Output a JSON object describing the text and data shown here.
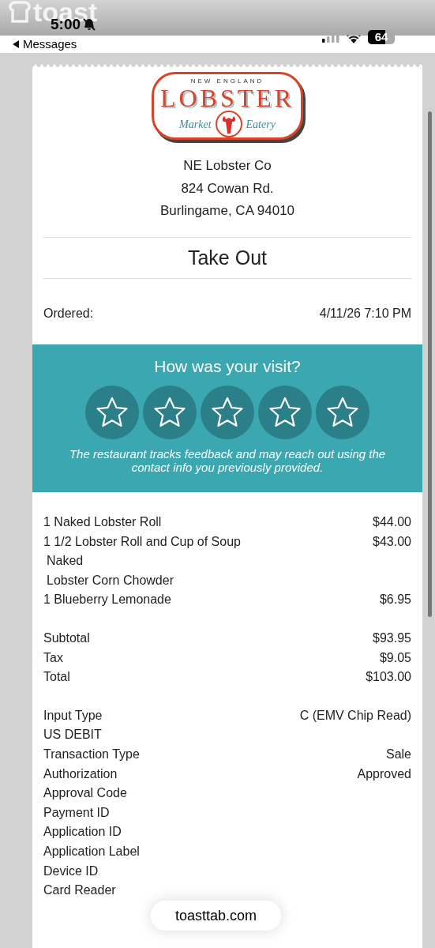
{
  "status_bar": {
    "time": "5:00",
    "back_label": "Messages",
    "battery": "64"
  },
  "header": {
    "brand": "toast"
  },
  "logo": {
    "top": "NEW ENGLAND",
    "main": "LOBSTER",
    "left": "Market",
    "right": "Eatery"
  },
  "restaurant": {
    "lines": [
      "NE Lobster Co",
      "824 Cowan Rd.",
      "Burlingame, CA 94010"
    ]
  },
  "order_type": "Take Out",
  "ordered": {
    "label": "Ordered:",
    "value": "4/11/26 7:10 PM"
  },
  "feedback": {
    "title": "How was your visit?",
    "note": "The restaurant tracks feedback and may reach out using the contact info you previously provided."
  },
  "items": [
    {
      "kind": "item",
      "name": "1 Naked Lobster Roll",
      "price": "$44.00"
    },
    {
      "kind": "item",
      "name": "1 1/2 Lobster Roll and Cup of Soup",
      "price": "$43.00"
    },
    {
      "kind": "modifier",
      "name": "Naked"
    },
    {
      "kind": "modifier",
      "name": "Lobster Corn Chowder"
    },
    {
      "kind": "item",
      "name": "1 Blueberry Lemonade",
      "price": "$6.95"
    }
  ],
  "totals": [
    {
      "label": "Subtotal",
      "value": "$93.95"
    },
    {
      "label": "Tax",
      "value": "$9.05"
    },
    {
      "label": "Total",
      "value": "$103.00"
    }
  ],
  "payment": [
    {
      "label": "Input Type",
      "value": "C (EMV Chip Read)"
    },
    {
      "label": "US DEBIT"
    },
    {
      "label": "Transaction Type",
      "value": "Sale"
    },
    {
      "label": "Authorization",
      "value": "Approved"
    },
    {
      "label": "Approval Code"
    },
    {
      "label": "Payment ID"
    },
    {
      "label": "Application ID"
    },
    {
      "label": "Application Label"
    },
    {
      "label": "Device ID"
    },
    {
      "label": "Card Reader"
    }
  ],
  "url_pill": "toasttab.com"
}
